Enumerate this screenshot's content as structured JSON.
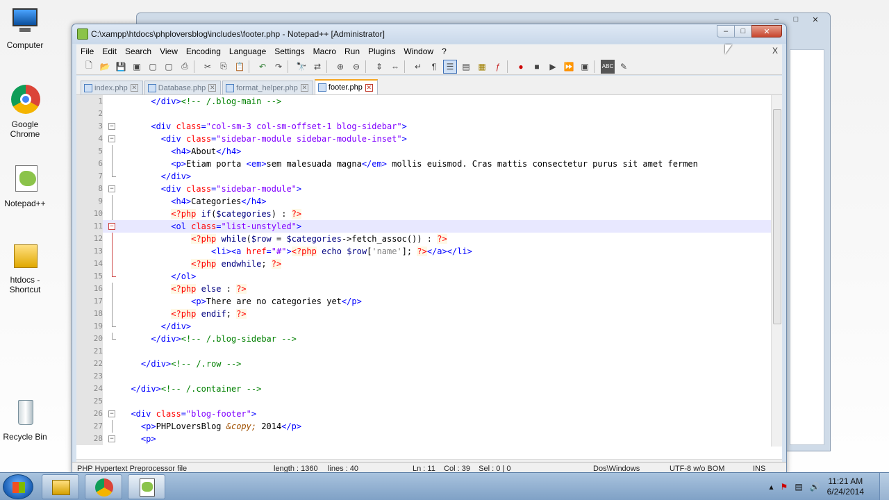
{
  "desktop": {
    "icons": [
      {
        "label": "Computer"
      },
      {
        "label": "Google Chrome"
      },
      {
        "label": "Notepad++"
      },
      {
        "label": "htdocs - Shortcut"
      },
      {
        "label": "Recycle Bin"
      }
    ]
  },
  "window": {
    "title": "C:\\xampp\\htdocs\\phploversblog\\includes\\footer.php - Notepad++ [Administrator]",
    "controls": {
      "minimize": "–",
      "maximize": "□",
      "close": "✕"
    }
  },
  "menu": {
    "items": [
      "File",
      "Edit",
      "Search",
      "View",
      "Encoding",
      "Language",
      "Settings",
      "Macro",
      "Run",
      "Plugins",
      "Window",
      "?"
    ],
    "close_doc": "X"
  },
  "tabs": [
    {
      "label": "index.php",
      "active": false
    },
    {
      "label": "Database.php",
      "active": false
    },
    {
      "label": "format_helper.php",
      "active": false
    },
    {
      "label": "footer.php",
      "active": true
    }
  ],
  "editor": {
    "current_line": 11,
    "line_numbers": [
      "1",
      "2",
      "3",
      "4",
      "5",
      "6",
      "7",
      "8",
      "9",
      "10",
      "11",
      "12",
      "13",
      "14",
      "15",
      "16",
      "17",
      "18",
      "19",
      "20",
      "21",
      "22",
      "23",
      "24",
      "25",
      "26",
      "27",
      "28"
    ]
  },
  "status": {
    "file_type": "PHP Hypertext Preprocessor file",
    "length": "length : 1360",
    "lines": "lines : 40",
    "position": "Ln : 11    Col : 39    Sel : 0 | 0",
    "eol": "Dos\\Windows",
    "encoding": "UTF-8 w/o BOM",
    "mode": "INS"
  },
  "taskbar": {
    "time": "11:21 AM",
    "date": "6/24/2014"
  }
}
